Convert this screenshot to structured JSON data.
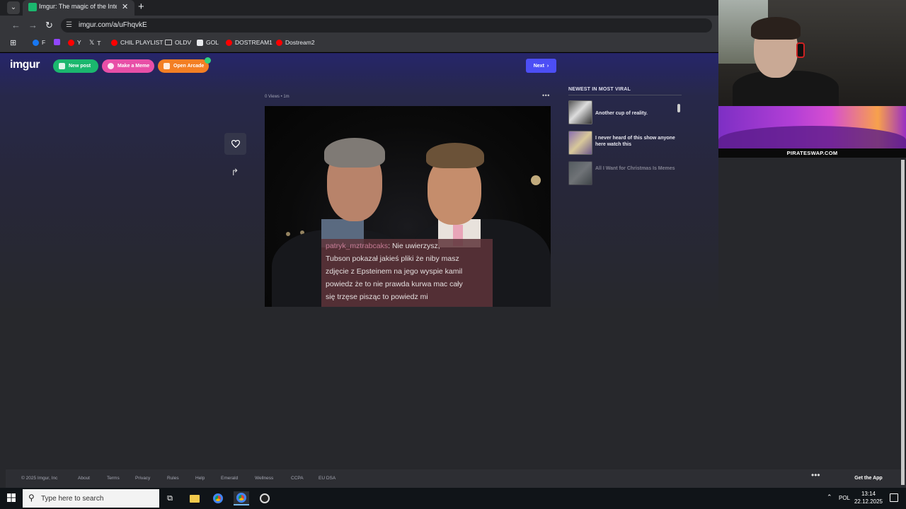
{
  "browser": {
    "tab_title": "Imgur: The magic of the Interne",
    "url": "imgur.com/a/uFhqvkE",
    "bookmarks": [
      "F",
      "Y",
      "T",
      "CHIL PLAYLIST",
      "OLDV",
      "GOL",
      "DOSTREAM1",
      "Dostream2"
    ]
  },
  "imgur": {
    "logo": "imgur",
    "new_post": "New post",
    "make_meme": "Make a Meme",
    "open_arcade": "Open Arcade",
    "next": "Next",
    "post_meta": "0 Views • 1m",
    "post_caption": {
      "username": "patryk_mztrabcaks",
      "lines": [
        ": Nie uwierzysz,",
        "Tubson pokazał jakieś pliki że niby masz",
        "zdjęcie z Epsteinem na jego wyspie kamil",
        "powiedz że to nie prawda kurwa mac cały",
        "się trzęse pisząc to powiedz mi"
      ]
    },
    "sidebar": {
      "title": "NEWEST IN MOST VIRAL",
      "items": [
        {
          "title": "Another cup of reality."
        },
        {
          "title": "I never heard of this show anyone here watch this"
        },
        {
          "title": "All I Want for Christmas Is Memes"
        }
      ]
    },
    "footer": {
      "copyright": "© 2025 Imgur, Inc",
      "links": [
        "About",
        "Terms",
        "Privacy",
        "Rules",
        "Help",
        "Emerald",
        "Wellness",
        "CCPA",
        "EU DSA"
      ],
      "get_app": "Get the App"
    }
  },
  "overlay": {
    "ad_caption": "PIRATESWAP.COM"
  },
  "taskbar": {
    "search_placeholder": "Type here to search",
    "language": "POL",
    "time": "13:14",
    "date": "22.12.2025"
  },
  "colors": {
    "imgur_green": "#1bb76e",
    "imgur_pink": "#e84fa7",
    "imgur_orange": "#f37f24",
    "next_blue": "#4c4ef5"
  }
}
